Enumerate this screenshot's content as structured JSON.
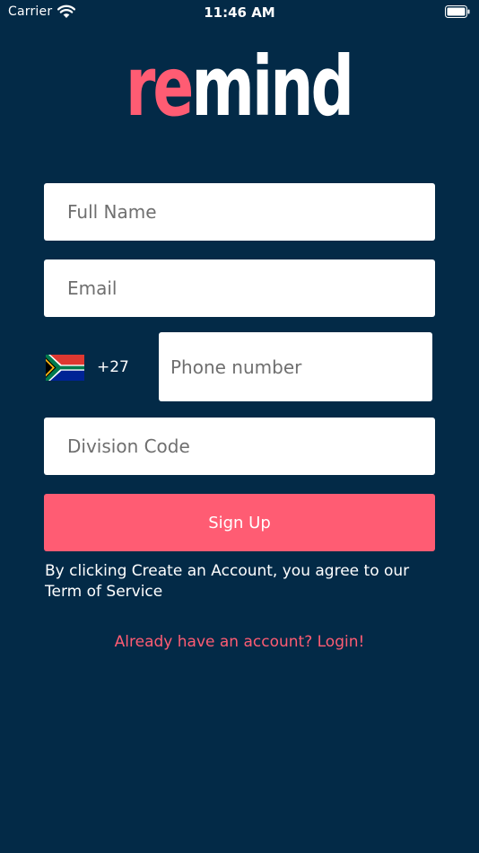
{
  "status_bar": {
    "carrier": "Carrier",
    "time": "11:46 AM"
  },
  "logo": {
    "text_accent": "re",
    "text_rest": "mind",
    "accent_color": "#ff5c73",
    "text_color": "#ffffff"
  },
  "form": {
    "full_name": {
      "value": "",
      "placeholder": "Full Name"
    },
    "email": {
      "value": "",
      "placeholder": "Email"
    },
    "phone": {
      "country_flag": "south-africa-flag-icon",
      "dial_code": "+27",
      "value": "",
      "placeholder": "Phone number"
    },
    "division_code": {
      "value": "",
      "placeholder": "Division Code"
    },
    "submit_label": "Sign Up"
  },
  "terms": {
    "line1": "By clicking Create an Account, you agree to our",
    "line2": "Term of Service"
  },
  "login_link": "Already have an account? Login!",
  "colors": {
    "background": "#032a47",
    "accent": "#ff5c73",
    "field_background": "#ffffff"
  }
}
